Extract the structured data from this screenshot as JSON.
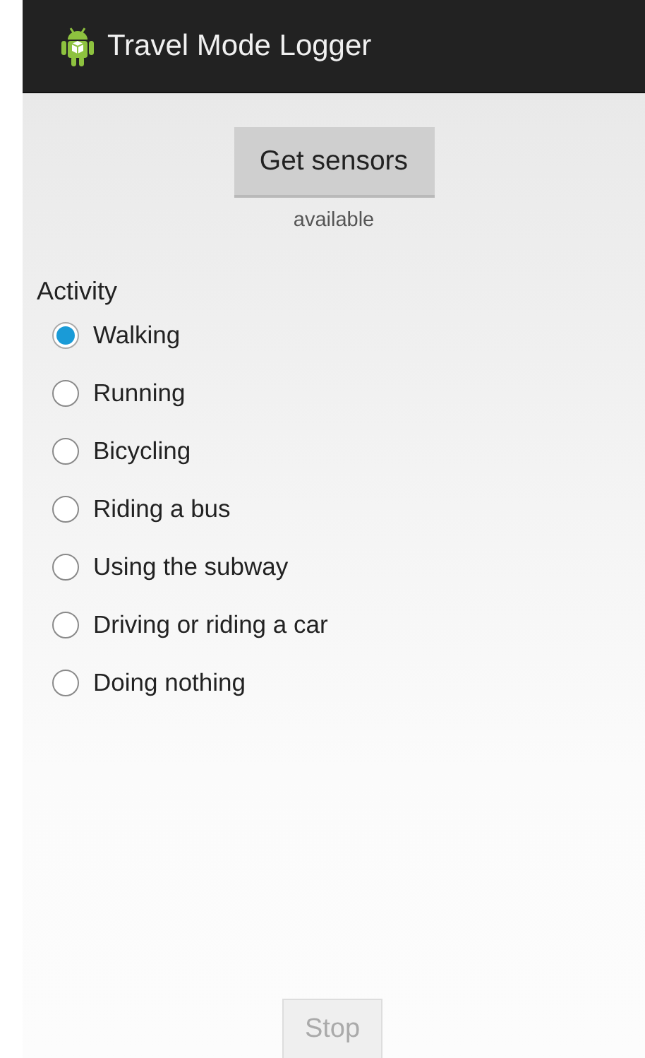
{
  "action_bar": {
    "title": "Travel Mode Logger"
  },
  "sensors_button": {
    "label": "Get sensors"
  },
  "sensors_status": "available",
  "activity": {
    "label": "Activity",
    "options": [
      {
        "label": "Walking",
        "selected": true
      },
      {
        "label": "Running",
        "selected": false
      },
      {
        "label": "Bicycling",
        "selected": false
      },
      {
        "label": "Riding a bus",
        "selected": false
      },
      {
        "label": "Using the subway",
        "selected": false
      },
      {
        "label": "Driving or riding a car",
        "selected": false
      },
      {
        "label": "Doing nothing",
        "selected": false
      }
    ]
  },
  "stop_button": {
    "label": "Stop",
    "disabled": true
  }
}
